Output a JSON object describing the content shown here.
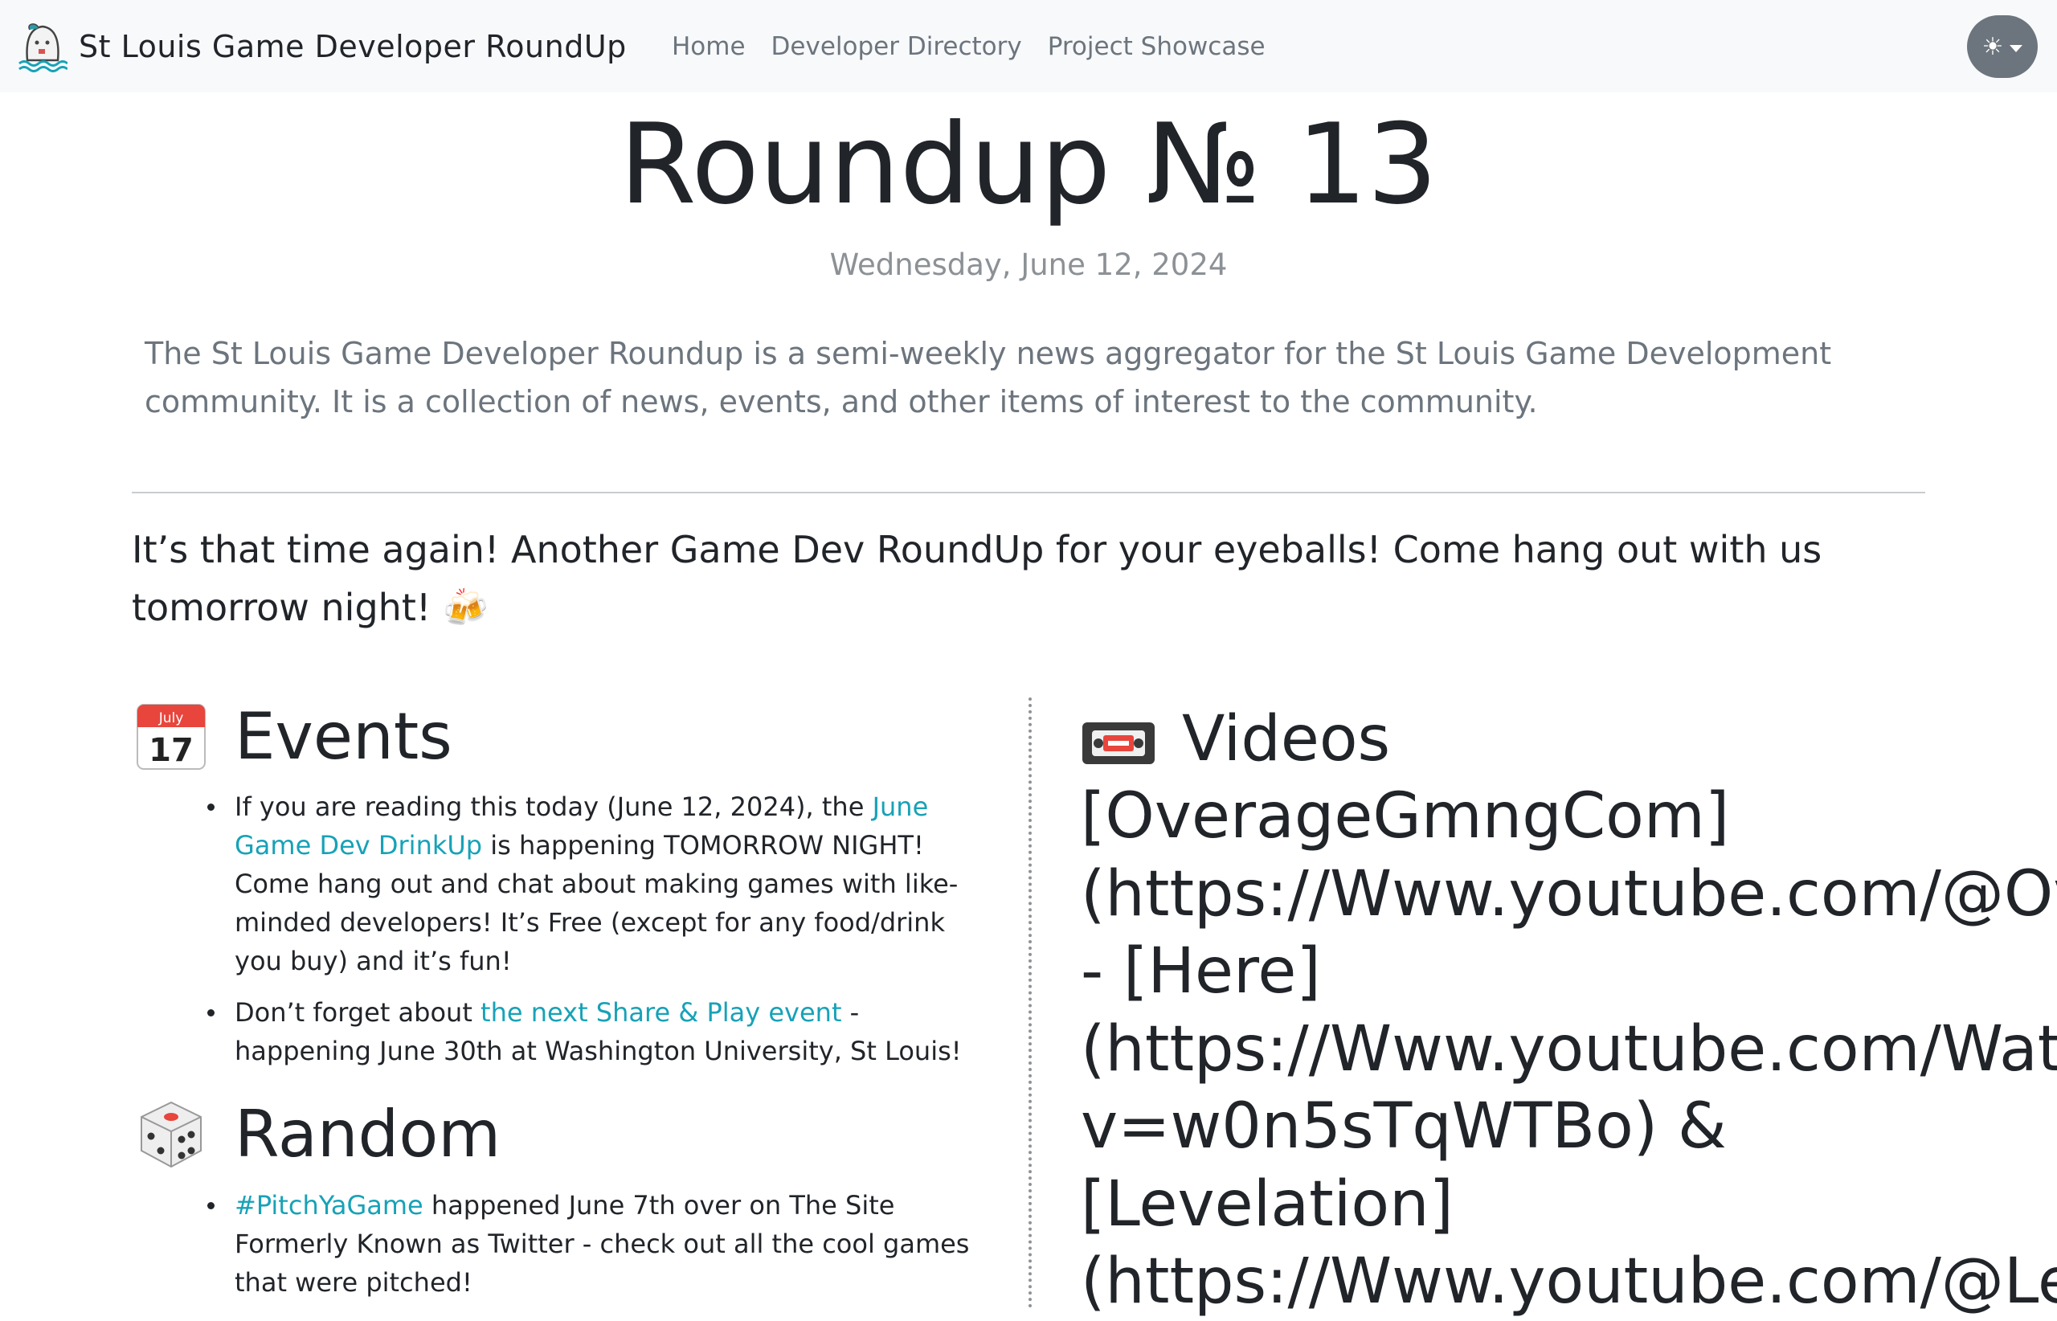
{
  "navbar": {
    "brand": "St Louis Game Developer RoundUp",
    "links": [
      "Home",
      "Developer Directory",
      "Project Showcase"
    ],
    "theme_toggle_icon": "sun-icon"
  },
  "header": {
    "title": "Roundup № 13",
    "date": "Wednesday, June 12, 2024",
    "intro": "The St Louis Game Developer Roundup is a semi-weekly news aggregator for the St Louis Game Development community. It is a collection of news, events, and other items of interest to the community."
  },
  "lead": "It’s that time again! Another Game Dev RoundUp for your eyeballs! Come hang out with us tomorrow night! 🍻",
  "events": {
    "heading": "Events",
    "calendar": {
      "month": "July",
      "day": "17"
    },
    "items": [
      {
        "before": "If you are reading this today (June 12, 2024), the ",
        "link": "June Game Dev DrinkUp",
        "after": " is happening TOMORROW NIGHT! Come hang out and chat about making games with like-minded developers! It’s Free (except for any food/drink you buy) and it’s fun!"
      },
      {
        "before": "Don’t forget about ",
        "link": "the next Share & Play event",
        "after": " - happening June 30th at Washington University, St Louis!"
      }
    ]
  },
  "random": {
    "heading": "Random",
    "items": [
      {
        "before": "",
        "link": "#PitchYaGame",
        "after": " happened June 7th over on The Site Formerly Known as Twitter - check out all the cool games that were pitched!"
      }
    ]
  },
  "videos": {
    "heading": "Videos",
    "body_lines": [
      "[OverageGmngCom]",
      "(https://Www.youtube.com/@Ov",
      "- [Here]",
      "(https://Www.youtube.com/Wat",
      "v=w0n5sTqWTBo) &",
      "[Levelation]",
      "(https://Www.youtube.com/@Le"
    ]
  },
  "colors": {
    "navbar_bg": "#f8f9fa",
    "link": "#17a2b8",
    "muted": "#6c757d",
    "toggle_bg": "#6c757d"
  }
}
